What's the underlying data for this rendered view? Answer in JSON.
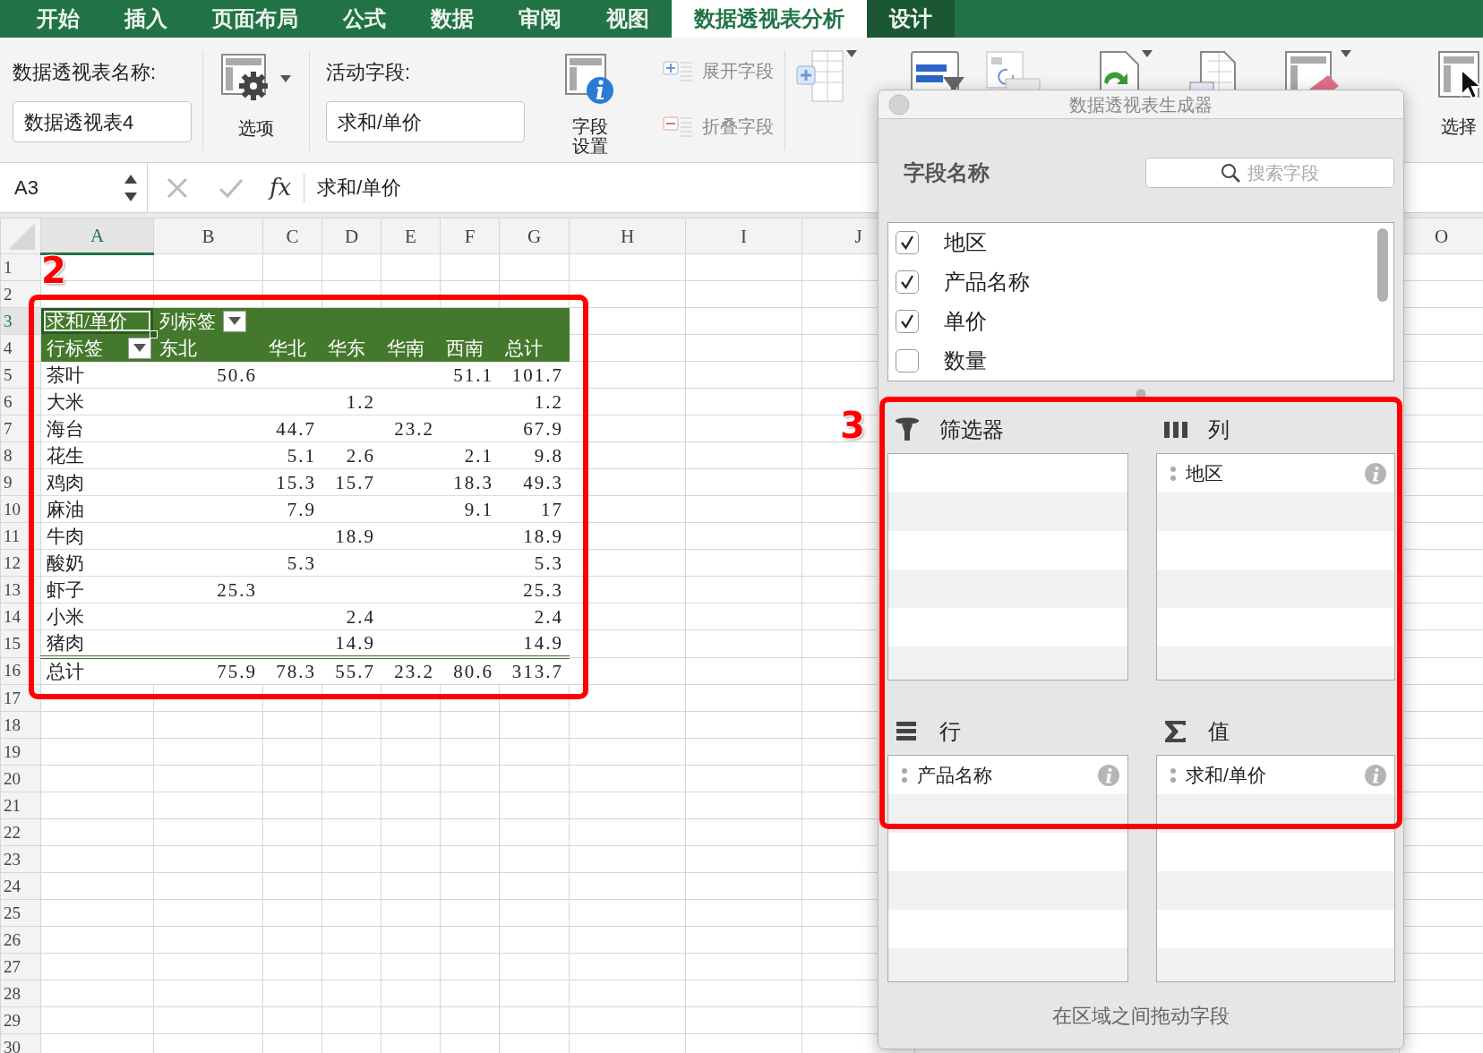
{
  "tabs": [
    {
      "label": "开始",
      "selected": false,
      "kind": "normal"
    },
    {
      "label": "插入",
      "selected": false,
      "kind": "normal"
    },
    {
      "label": "页面布局",
      "selected": false,
      "kind": "normal"
    },
    {
      "label": "公式",
      "selected": false,
      "kind": "normal"
    },
    {
      "label": "数据",
      "selected": false,
      "kind": "normal"
    },
    {
      "label": "审阅",
      "selected": false,
      "kind": "normal"
    },
    {
      "label": "视图",
      "selected": false,
      "kind": "normal"
    },
    {
      "label": "数据透视表分析",
      "selected": true,
      "kind": "contextual"
    },
    {
      "label": "设计",
      "selected": false,
      "kind": "contextual"
    }
  ],
  "ribbon": {
    "pivot_name": {
      "label": "数据透视表名称:",
      "value": "数据透视表4"
    },
    "options": {
      "label": "选项"
    },
    "active_field": {
      "label": "活动字段:",
      "value": "求和/单价"
    },
    "field_settings": {
      "label_lines": [
        "字段",
        "设置"
      ]
    },
    "expand": {
      "label": "展开字段",
      "disabled": true
    },
    "collapse": {
      "label": "折叠字段",
      "disabled": true
    },
    "select": {
      "label": "选择"
    }
  },
  "formula_bar": {
    "cell": "A3",
    "function_label": "fx",
    "content": "求和/单价"
  },
  "sheet": {
    "columns": [
      {
        "label": "A",
        "selected": true
      },
      {
        "label": "B",
        "selected": false
      },
      {
        "label": "C",
        "selected": false
      },
      {
        "label": "D",
        "selected": false
      },
      {
        "label": "E",
        "selected": false
      },
      {
        "label": "F",
        "selected": false
      },
      {
        "label": "G",
        "selected": false
      },
      {
        "label": "H",
        "selected": false
      },
      {
        "label": "I",
        "selected": false
      },
      {
        "label": "J",
        "selected": false
      },
      {
        "label": "O",
        "selected": false
      }
    ],
    "rows": [
      {
        "label": "1",
        "selected": false
      },
      {
        "label": "2",
        "selected": false
      },
      {
        "label": "3",
        "selected": true
      },
      {
        "label": "4",
        "selected": false
      },
      {
        "label": "5",
        "selected": false
      },
      {
        "label": "6",
        "selected": false
      },
      {
        "label": "7",
        "selected": false
      },
      {
        "label": "8",
        "selected": false
      },
      {
        "label": "9",
        "selected": false
      },
      {
        "label": "10",
        "selected": false
      },
      {
        "label": "11",
        "selected": false
      },
      {
        "label": "12",
        "selected": false
      },
      {
        "label": "13",
        "selected": false
      },
      {
        "label": "14",
        "selected": false
      },
      {
        "label": "15",
        "selected": false
      },
      {
        "label": "16",
        "selected": false
      },
      {
        "label": "17",
        "selected": false
      },
      {
        "label": "18",
        "selected": false
      },
      {
        "label": "19",
        "selected": false
      },
      {
        "label": "20",
        "selected": false
      },
      {
        "label": "21",
        "selected": false
      },
      {
        "label": "22",
        "selected": false
      },
      {
        "label": "23",
        "selected": false
      },
      {
        "label": "24",
        "selected": false
      },
      {
        "label": "25",
        "selected": false
      },
      {
        "label": "26",
        "selected": false
      },
      {
        "label": "27",
        "selected": false
      },
      {
        "label": "28",
        "selected": false
      },
      {
        "label": "29",
        "selected": false
      },
      {
        "label": "30",
        "selected": false
      }
    ]
  },
  "pivot": {
    "value_field": "求和/单价",
    "column_label": "列标签",
    "row_label": "行标签",
    "columns": [
      "东北",
      "华北",
      "华东",
      "华南",
      "西南",
      "总计"
    ],
    "rows": [
      {
        "label": "茶叶",
        "values": {
          "c1": "50.6",
          "c5": "51.1",
          "c6": "101.7"
        }
      },
      {
        "label": "大米",
        "values": {
          "c3": "1.2",
          "c6": "1.2"
        }
      },
      {
        "label": "海台",
        "values": {
          "c2": "44.7",
          "c4": "23.2",
          "c6": "67.9"
        }
      },
      {
        "label": "花生",
        "values": {
          "c2": "5.1",
          "c3": "2.6",
          "c5": "2.1",
          "c6": "9.8"
        }
      },
      {
        "label": "鸡肉",
        "values": {
          "c2": "15.3",
          "c3": "15.7",
          "c5": "18.3",
          "c6": "49.3"
        }
      },
      {
        "label": "麻油",
        "values": {
          "c2": "7.9",
          "c5": "9.1",
          "c6": "17"
        }
      },
      {
        "label": "牛肉",
        "values": {
          "c3": "18.9",
          "c6": "18.9"
        }
      },
      {
        "label": "酸奶",
        "values": {
          "c2": "5.3",
          "c6": "5.3"
        }
      },
      {
        "label": "虾子",
        "values": {
          "c1": "25.3",
          "c6": "25.3"
        }
      },
      {
        "label": "小米",
        "values": {
          "c3": "2.4",
          "c6": "2.4"
        }
      },
      {
        "label": "猪肉",
        "values": {
          "c3": "14.9",
          "c6": "14.9"
        }
      }
    ],
    "total": {
      "label": "总计",
      "values": {
        "c1": "75.9",
        "c2": "78.3",
        "c3": "55.7",
        "c4": "23.2",
        "c5": "80.6",
        "c6": "313.7"
      }
    }
  },
  "builder": {
    "title": "数据透视表生成器",
    "fields_label": "字段名称",
    "search": {
      "placeholder": "搜索字段"
    },
    "fields": [
      {
        "label": "地区",
        "checked": true
      },
      {
        "label": "产品名称",
        "checked": true
      },
      {
        "label": "单价",
        "checked": true
      },
      {
        "label": "数量",
        "checked": false
      }
    ],
    "areas": [
      {
        "kind": "filter",
        "title": "筛选器"
      },
      {
        "kind": "columns",
        "title": "列",
        "items": [
          "地区"
        ]
      },
      {
        "kind": "rows",
        "title": "行",
        "items": [
          "产品名称"
        ]
      },
      {
        "kind": "values",
        "title": "值",
        "items": [
          "求和/单价"
        ]
      }
    ],
    "hint": "在区域之间拖动字段"
  },
  "annotations": [
    {
      "label": "2"
    },
    {
      "label": "3"
    }
  ]
}
